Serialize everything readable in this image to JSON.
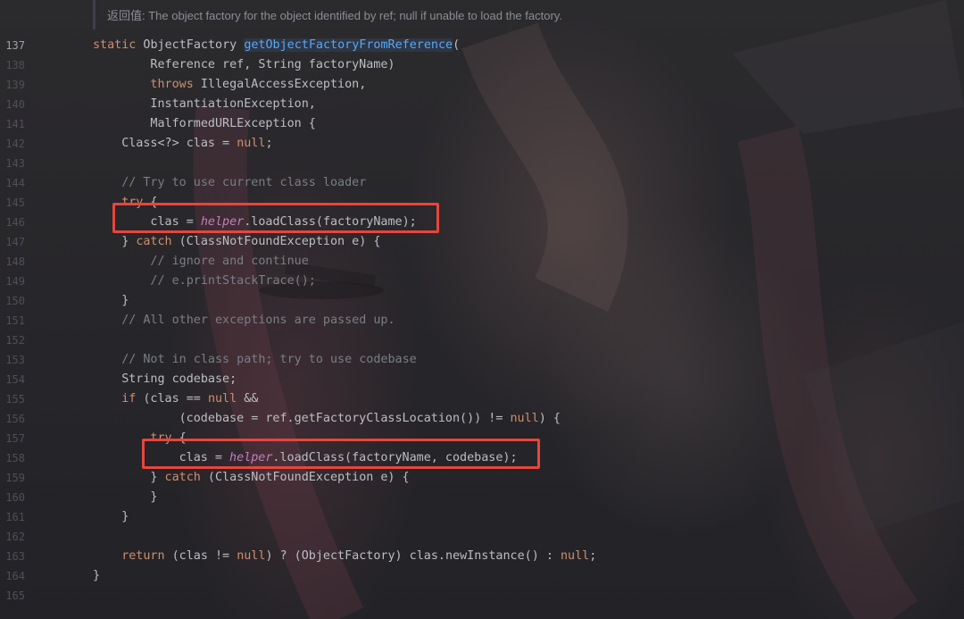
{
  "doc": {
    "returns_label": "返回值:",
    "returns_text": " The object factory for the object identified by ref; null if unable to load the factory."
  },
  "lines": [
    {
      "n": "137",
      "current": true,
      "indent": 0,
      "tokens": [
        {
          "t": "static",
          "c": "kw"
        },
        {
          "t": " ObjectFactory "
        },
        {
          "t": "getObjectFactoryFromReference",
          "c": "fn"
        },
        {
          "t": "("
        }
      ]
    },
    {
      "n": "138",
      "indent": 8,
      "tokens": [
        {
          "t": "Reference ref, String factoryName)"
        }
      ]
    },
    {
      "n": "139",
      "indent": 8,
      "tokens": [
        {
          "t": "throws",
          "c": "kw"
        },
        {
          "t": " IllegalAccessException,"
        }
      ]
    },
    {
      "n": "140",
      "indent": 8,
      "tokens": [
        {
          "t": "InstantiationException,"
        }
      ]
    },
    {
      "n": "141",
      "indent": 8,
      "tokens": [
        {
          "t": "MalformedURLException {"
        }
      ]
    },
    {
      "n": "142",
      "indent": 4,
      "tokens": [
        {
          "t": "Class<?> clas = "
        },
        {
          "t": "null",
          "c": "kw"
        },
        {
          "t": ";"
        }
      ]
    },
    {
      "n": "143",
      "indent": 0,
      "tokens": []
    },
    {
      "n": "144",
      "indent": 4,
      "tokens": [
        {
          "t": "// Try to use current class loader",
          "c": "cm"
        }
      ]
    },
    {
      "n": "145",
      "indent": 4,
      "tokens": [
        {
          "t": "try",
          "c": "kw"
        },
        {
          "t": " {"
        }
      ]
    },
    {
      "n": "146",
      "indent": 8,
      "tokens": [
        {
          "t": "clas = "
        },
        {
          "t": "helper",
          "c": "it"
        },
        {
          "t": ".loadClass(factoryName);"
        }
      ]
    },
    {
      "n": "147",
      "indent": 4,
      "tokens": [
        {
          "t": "} "
        },
        {
          "t": "catch",
          "c": "kw"
        },
        {
          "t": " (ClassNotFoundException e) {"
        }
      ]
    },
    {
      "n": "148",
      "indent": 8,
      "tokens": [
        {
          "t": "// ignore and continue",
          "c": "cm"
        }
      ]
    },
    {
      "n": "149",
      "indent": 8,
      "tokens": [
        {
          "t": "// e.printStackTrace();",
          "c": "cm"
        }
      ]
    },
    {
      "n": "150",
      "indent": 4,
      "tokens": [
        {
          "t": "}"
        }
      ]
    },
    {
      "n": "151",
      "indent": 4,
      "tokens": [
        {
          "t": "// All other exceptions are passed up.",
          "c": "cm"
        }
      ]
    },
    {
      "n": "152",
      "indent": 0,
      "tokens": []
    },
    {
      "n": "153",
      "indent": 4,
      "tokens": [
        {
          "t": "// Not in class path; try to use codebase",
          "c": "cm"
        }
      ]
    },
    {
      "n": "154",
      "indent": 4,
      "tokens": [
        {
          "t": "String codebase;"
        }
      ]
    },
    {
      "n": "155",
      "indent": 4,
      "tokens": [
        {
          "t": "if",
          "c": "kw"
        },
        {
          "t": " (clas == "
        },
        {
          "t": "null",
          "c": "kw"
        },
        {
          "t": " &&"
        }
      ]
    },
    {
      "n": "156",
      "indent": 12,
      "tokens": [
        {
          "t": "(codebase = ref.getFactoryClassLocation()) != "
        },
        {
          "t": "null",
          "c": "kw"
        },
        {
          "t": ") {"
        }
      ]
    },
    {
      "n": "157",
      "indent": 8,
      "tokens": [
        {
          "t": "try",
          "c": "kw"
        },
        {
          "t": " {"
        }
      ]
    },
    {
      "n": "158",
      "indent": 12,
      "tokens": [
        {
          "t": "clas = "
        },
        {
          "t": "helper",
          "c": "it"
        },
        {
          "t": ".loadClass(factoryName, codebase);"
        }
      ]
    },
    {
      "n": "159",
      "indent": 8,
      "tokens": [
        {
          "t": "} "
        },
        {
          "t": "catch",
          "c": "kw"
        },
        {
          "t": " (ClassNotFoundException e) {"
        }
      ]
    },
    {
      "n": "160",
      "indent": 8,
      "tokens": [
        {
          "t": "}"
        }
      ]
    },
    {
      "n": "161",
      "indent": 4,
      "tokens": [
        {
          "t": "}"
        }
      ]
    },
    {
      "n": "162",
      "indent": 0,
      "tokens": []
    },
    {
      "n": "163",
      "indent": 4,
      "tokens": [
        {
          "t": "return",
          "c": "kw"
        },
        {
          "t": " (clas != "
        },
        {
          "t": "null",
          "c": "kw"
        },
        {
          "t": ") ? (ObjectFactory) clas.newInstance() : "
        },
        {
          "t": "null",
          "c": "kw"
        },
        {
          "t": ";"
        }
      ]
    },
    {
      "n": "164",
      "indent": 0,
      "tokens": [
        {
          "t": "}"
        }
      ]
    },
    {
      "n": "165",
      "indent": 0,
      "tokens": []
    }
  ],
  "highlights": [
    {
      "line": "146",
      "color": "#e8453c"
    },
    {
      "line": "158",
      "color": "#e8453c"
    }
  ]
}
